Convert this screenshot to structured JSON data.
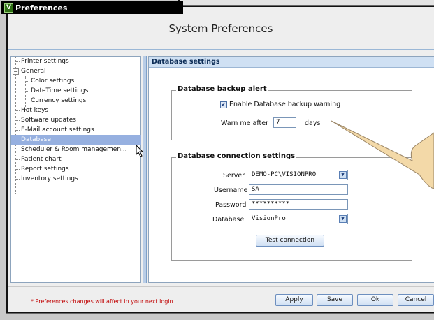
{
  "window": {
    "title": "Preferences",
    "logo_letter": "V"
  },
  "header": {
    "title": "System Preferences"
  },
  "tree": {
    "items": [
      {
        "label": "Printer settings"
      },
      {
        "label": "General"
      },
      {
        "label": "Color settings"
      },
      {
        "label": "DateTime settings"
      },
      {
        "label": "Currency settings"
      },
      {
        "label": "Hot keys"
      },
      {
        "label": "Software updates"
      },
      {
        "label": "E-Mail account settings"
      },
      {
        "label": "Database"
      },
      {
        "label": "Scheduler & Room managemen..."
      },
      {
        "label": "Patient chart"
      },
      {
        "label": "Report settings"
      },
      {
        "label": "Inventory settings"
      }
    ],
    "selected": "Database"
  },
  "panel": {
    "title": "Database settings",
    "backup": {
      "group_title": "Database backup alert",
      "enable_label": "Enable Database backup warning",
      "enable_checked": true,
      "warn_prefix": "Warn me after",
      "warn_value": "7",
      "warn_suffix": "days"
    },
    "connection": {
      "group_title": "Database connection settings",
      "server_label": "Server",
      "server_value": "DEMO-PC\\VISIONPRO",
      "username_label": "Username",
      "username_value": "SA",
      "password_label": "Password",
      "password_value": "**********",
      "database_label": "Database",
      "database_value": "VisionPro",
      "test_button": "Test connection"
    }
  },
  "footer": {
    "note": "* Preferences changes will affect in your next login.",
    "apply": "Apply",
    "save": "Save",
    "ok": "Ok",
    "cancel": "Cancel"
  },
  "colors": {
    "selection": "#96b0e0",
    "panel_header": "#cfe0f3",
    "callout": "#f3d9a8",
    "note": "#c00000"
  }
}
